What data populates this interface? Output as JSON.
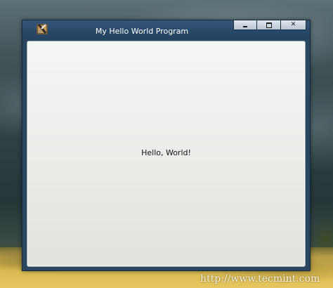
{
  "window": {
    "title": "My Hello World Program",
    "icon": "app-launcher-icon",
    "controls": {
      "minimize": "minimize-icon",
      "maximize": "maximize-icon",
      "close_label": "✕"
    }
  },
  "content": {
    "label": "Hello, World!"
  },
  "watermark": {
    "text": "http://www.tecmint.com"
  },
  "colors": {
    "titlebar": "#29496a",
    "client_background": "#ecebe8",
    "buttons": "#c9d3de"
  }
}
